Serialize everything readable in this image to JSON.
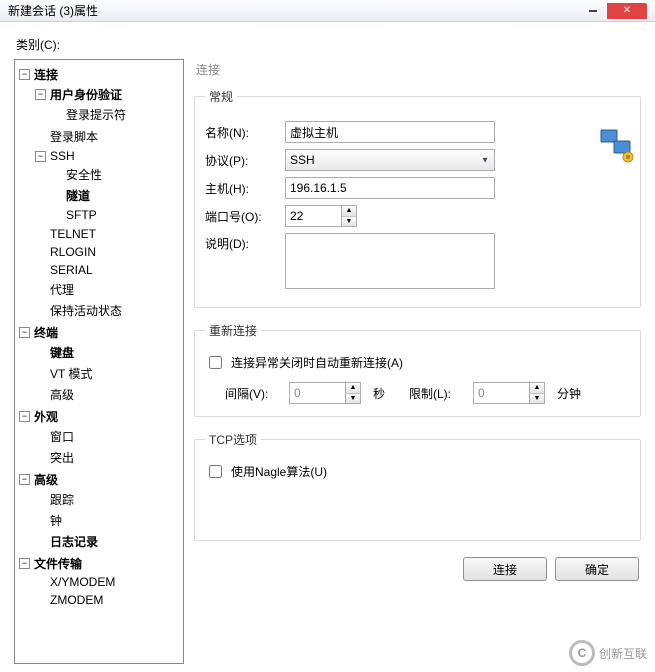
{
  "window": {
    "title": "新建会话 (3)属性",
    "category_label": "类别(C):"
  },
  "tree": {
    "connection": "连接",
    "logon": "用户身份验证",
    "logon_prompt": "登录提示符",
    "logon_script": "登录脚本",
    "ssh": "SSH",
    "security": "安全性",
    "tunnel": "隧道",
    "sftp": "SFTP",
    "telnet": "TELNET",
    "rlogin": "RLOGIN",
    "serial": "SERIAL",
    "proxy": "代理",
    "keepalive": "保持活动状态",
    "terminal": "终端",
    "keyboard": "键盘",
    "vtmode": "VT 模式",
    "advanced": "高级",
    "appearance": "外观",
    "window": "窗口",
    "highlight": "突出",
    "adv2": "高级",
    "trace": "跟踪",
    "bell": "钟",
    "logging": "日志记录",
    "filetrans": "文件传输",
    "xymodem": "X/YMODEM",
    "zmodem": "ZMODEM"
  },
  "panel": {
    "header": "连接",
    "general_legend": "常规",
    "name_label": "名称(N):",
    "name_value": "虚拟主机",
    "protocol_label": "协议(P):",
    "protocol_value": "SSH",
    "host_label": "主机(H):",
    "host_value": "196.16.1.5",
    "port_label": "端口号(O):",
    "port_value": "22",
    "desc_label": "说明(D):",
    "desc_value": "",
    "reconnect_legend": "重新连接",
    "reconnect_check": "连接异常关闭时自动重新连接(A)",
    "interval_label": "间隔(V):",
    "interval_value": "0",
    "interval_unit": "秒",
    "limit_label": "限制(L):",
    "limit_value": "0",
    "limit_unit": "分钟",
    "tcp_legend": "TCP选项",
    "nagle_check": "使用Nagle算法(U)"
  },
  "footer": {
    "connect": "连接",
    "ok": "确定"
  },
  "watermark": "创新互联"
}
